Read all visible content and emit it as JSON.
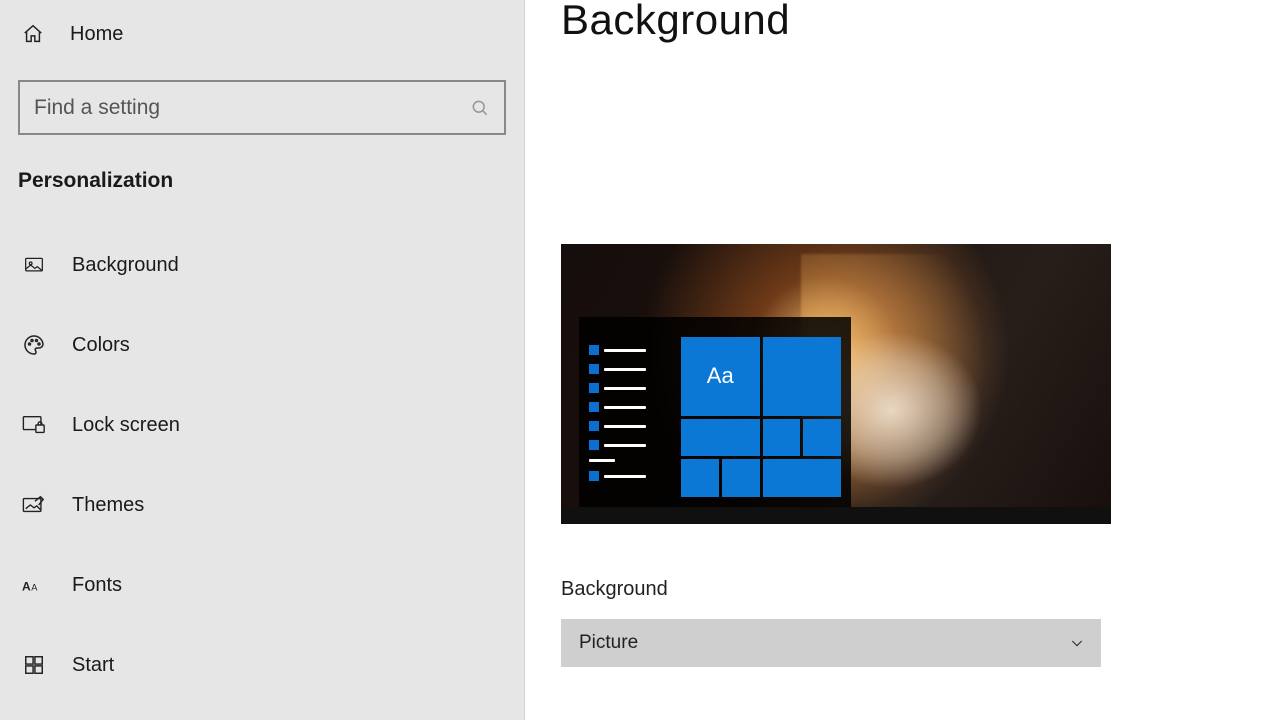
{
  "sidebar": {
    "home_label": "Home",
    "search_placeholder": "Find a setting",
    "group_header": "Personalization",
    "items": [
      {
        "icon": "picture-icon",
        "label": "Background"
      },
      {
        "icon": "palette-icon",
        "label": "Colors"
      },
      {
        "icon": "lock-screen-icon",
        "label": "Lock screen"
      },
      {
        "icon": "themes-icon",
        "label": "Themes"
      },
      {
        "icon": "fonts-icon",
        "label": "Fonts"
      },
      {
        "icon": "start-icon",
        "label": "Start"
      }
    ]
  },
  "main": {
    "title": "Background",
    "preview_sample_text": "Aa",
    "dropdown_label": "Background",
    "dropdown_value": "Picture",
    "accent_color": "#0a78d4"
  }
}
